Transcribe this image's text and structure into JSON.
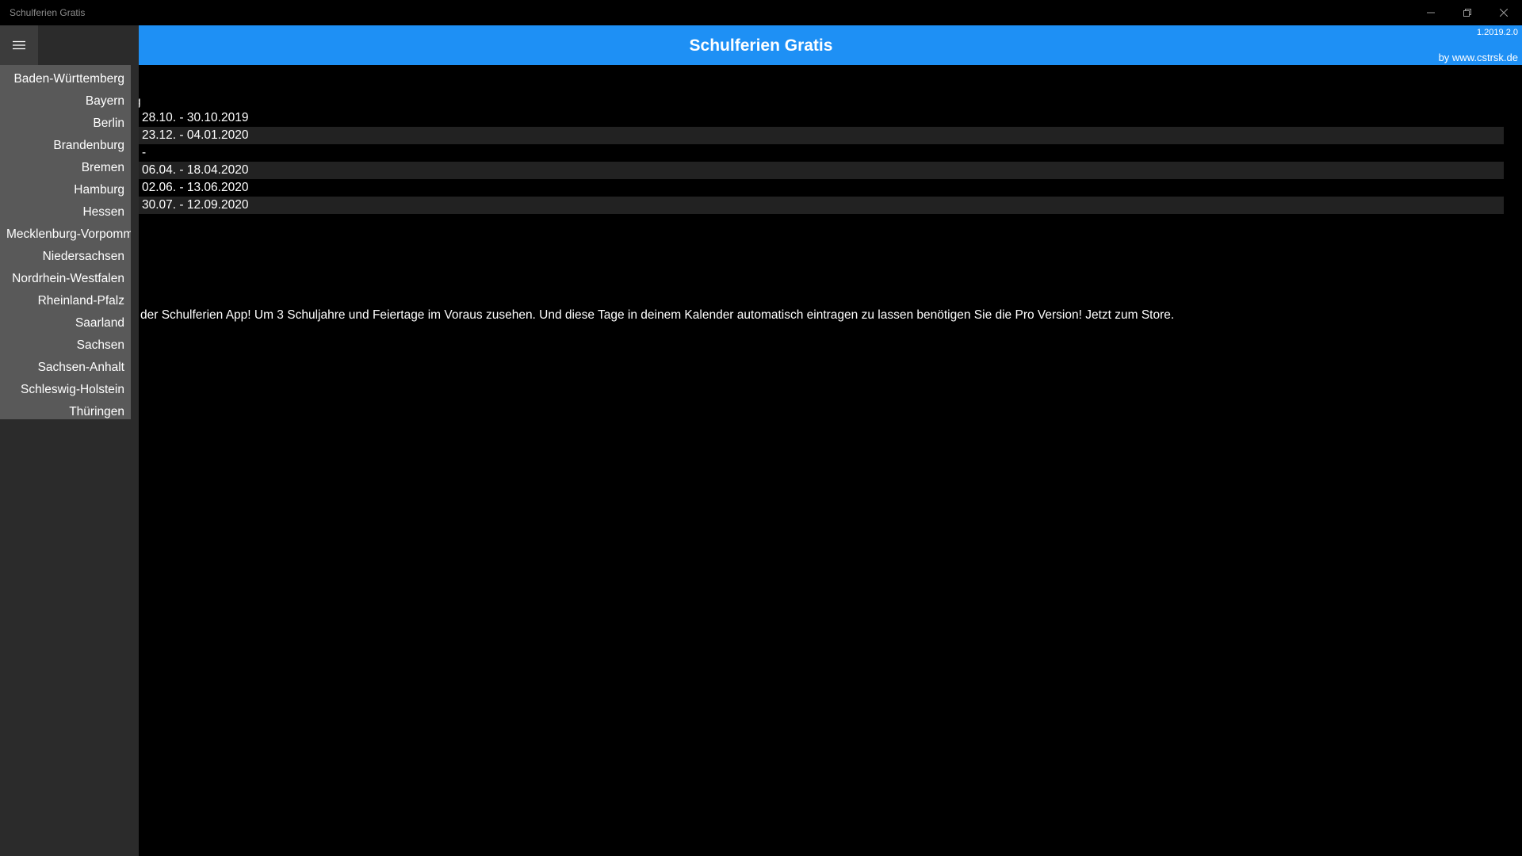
{
  "window": {
    "title": "Schulferien Gratis"
  },
  "header": {
    "title": "Schulferien Gratis",
    "version": "1.2019.2.0",
    "by": "by www.cstrsk.de"
  },
  "sidebar": {
    "items": [
      "Baden-Württemberg",
      "Bayern",
      "Berlin",
      "Brandenburg",
      "Bremen",
      "Hamburg",
      "Hessen",
      "Mecklenburg-Vorpommern",
      "Niedersachsen",
      "Nordrhein-Westfalen",
      "Rheinland-Pfalz",
      "Saarland",
      "Sachsen",
      "Sachsen-Anhalt",
      "Schleswig-Holstein",
      "Thüringen"
    ]
  },
  "content": {
    "section_label": "g",
    "holidays": [
      "28.10. - 30.10.2019",
      "23.12. - 04.01.2020",
      "-",
      "06.04. - 18.04.2020",
      "02.06. - 13.06.2020",
      "30.07. - 12.09.2020"
    ],
    "promo": "der Schulferien App! Um 3 Schuljahre und Feiertage im Voraus zusehen. Und diese Tage in deinem Kalender automatisch eintragen zu lassen benötigen Sie die Pro Version! Jetzt zum Store."
  },
  "colors": {
    "accent": "#1e90f5",
    "sidebar_list": "#595959",
    "sidebar": "#2b2b2b",
    "background": "#000000",
    "row_alt": "#222222"
  },
  "icons": {
    "menu": "hamburger-menu-icon",
    "minimize": "minimize-icon",
    "restore": "restore-icon",
    "close": "close-icon"
  }
}
